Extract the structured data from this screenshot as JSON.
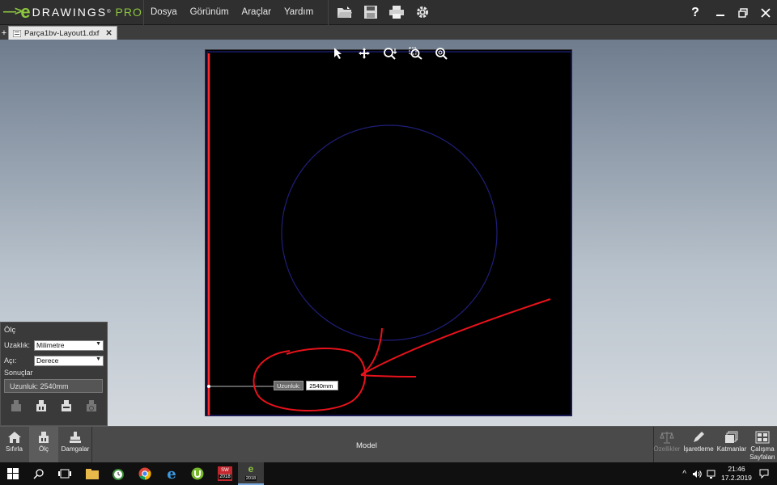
{
  "app": {
    "brand": "DRAWINGS",
    "edition": "PRO",
    "menus": [
      "Dosya",
      "Görünüm",
      "Araçlar",
      "Yardım"
    ],
    "help_label": "?"
  },
  "tabs": [
    {
      "label": "Parça1bv-Layout1.dxf"
    }
  ],
  "measure_panel": {
    "title": "Ölç",
    "distance_label": "Uzaklık:",
    "distance_unit": "Milimetre",
    "angle_label": "Açı:",
    "angle_unit": "Derece",
    "results_title": "Sonuçlar",
    "result_text": "Uzunluk: 2540mm"
  },
  "canvas": {
    "tooltip_label": "Uzunluk:",
    "tooltip_value": "2540mm",
    "colors": {
      "circle": "#1f1f7a",
      "border": "#1a1a66",
      "measure_line": "#ff2a2a",
      "annotation": "#e8121b"
    }
  },
  "bottom_bar": {
    "left_buttons": [
      "Sıfırla",
      "Ölç",
      "Damgalar"
    ],
    "center_tab": "Model",
    "right_buttons": [
      "Özellikler",
      "İşaretleme",
      "Katmanlar",
      "Çalışma\nSayfaları"
    ]
  },
  "taskbar": {
    "time": "21:46",
    "date": "17.2.2019",
    "sw_badge_top": "SW",
    "sw_badge_year": "2018",
    "ed_badge_year": "2018"
  },
  "colors": {
    "accent": "#8dc63f",
    "titlebar": "#2f2f2f"
  }
}
